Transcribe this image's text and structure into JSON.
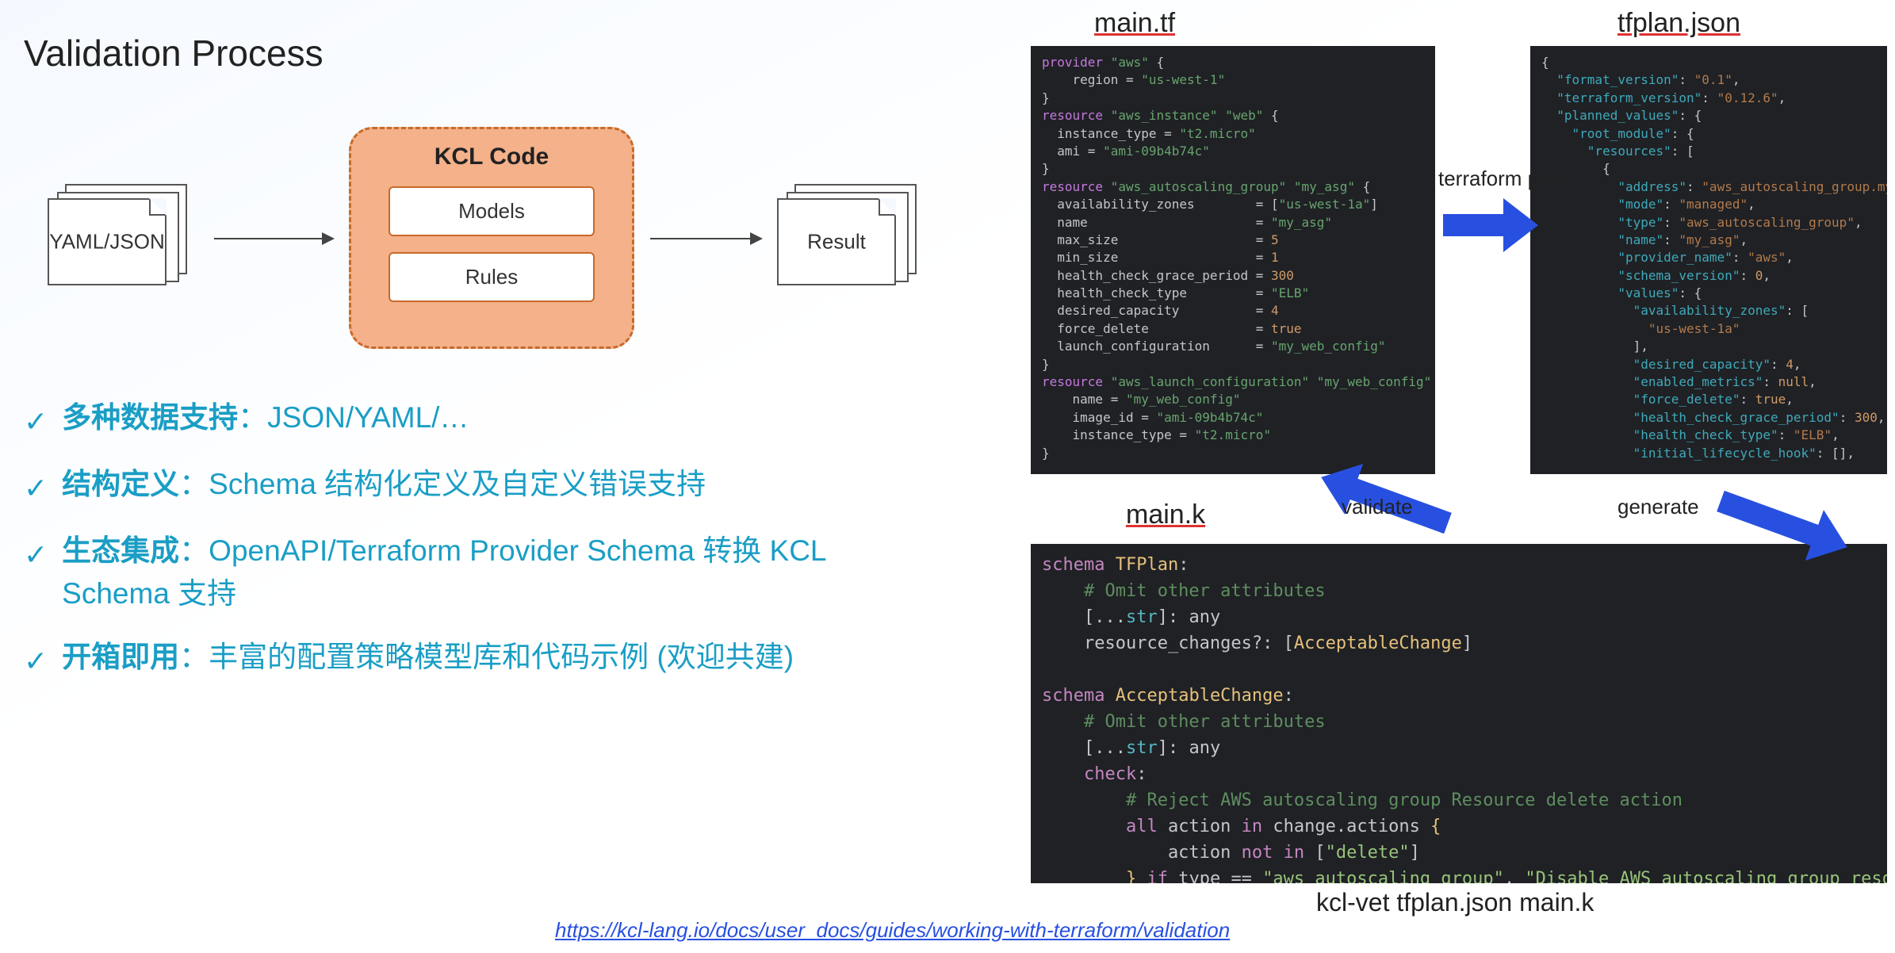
{
  "title": "Validation Process",
  "diagram": {
    "yaml_label": "YAML/JSON",
    "kcl_title": "KCL Code",
    "models_label": "Models",
    "rules_label": "Rules",
    "result_label": "Result"
  },
  "bullets": [
    {
      "bold": "多种数据支持",
      "rest": "：JSON/YAML/…"
    },
    {
      "bold": "结构定义",
      "rest": "：Schema 结构化定义及自定义错误支持"
    },
    {
      "bold": "生态集成",
      "rest": "：OpenAPI/Terraform Provider Schema 转换 KCL Schema 支持"
    },
    {
      "bold": "开箱即用",
      "rest": "：丰富的配置策略模型库和代码示例 (欢迎共建)"
    }
  ],
  "labels": {
    "maintf": "main.tf",
    "tfplan": "tfplan.json",
    "maink": "main.k",
    "terraform_plan": "terraform plan",
    "validate": "validate",
    "generate": "generate",
    "bottom_cmd": "kcl-vet tfplan.json main.k"
  },
  "code": {
    "maintf": [
      [
        "kw",
        "provider"
      ],
      [
        "id",
        " "
      ],
      [
        "str",
        "\"aws\""
      ],
      [
        "id",
        " {"
      ],
      null,
      [
        "id",
        "    region "
      ],
      [
        "eq",
        "= "
      ],
      [
        "str",
        "\"us-west-1\""
      ],
      null,
      [
        "id",
        "}"
      ],
      null,
      [
        "kw",
        "resource"
      ],
      [
        "id",
        " "
      ],
      [
        "str",
        "\"aws_instance\" \"web\""
      ],
      [
        "id",
        " {"
      ],
      null,
      [
        "id",
        "  instance_type "
      ],
      [
        "eq",
        "= "
      ],
      [
        "str",
        "\"t2.micro\""
      ],
      null,
      [
        "id",
        "  ami "
      ],
      [
        "eq",
        "= "
      ],
      [
        "str",
        "\"ami-09b4b74c\""
      ],
      null,
      [
        "id",
        "}"
      ],
      null,
      [
        "kw",
        "resource"
      ],
      [
        "id",
        " "
      ],
      [
        "str",
        "\"aws_autoscaling_group\" \"my_asg\""
      ],
      [
        "id",
        " {"
      ],
      null,
      [
        "id",
        "  availability_zones        "
      ],
      [
        "eq",
        "= "
      ],
      [
        "id",
        "["
      ],
      [
        "str",
        "\"us-west-1a\""
      ],
      [
        "id",
        "]"
      ],
      null,
      [
        "id",
        "  name                      "
      ],
      [
        "eq",
        "= "
      ],
      [
        "str",
        "\"my_asg\""
      ],
      null,
      [
        "id",
        "  max_size                  "
      ],
      [
        "eq",
        "= "
      ],
      [
        "num",
        "5"
      ],
      null,
      [
        "id",
        "  min_size                  "
      ],
      [
        "eq",
        "= "
      ],
      [
        "num",
        "1"
      ],
      null,
      [
        "id",
        "  health_check_grace_period "
      ],
      [
        "eq",
        "= "
      ],
      [
        "num",
        "300"
      ],
      null,
      [
        "id",
        "  health_check_type         "
      ],
      [
        "eq",
        "= "
      ],
      [
        "str",
        "\"ELB\""
      ],
      null,
      [
        "id",
        "  desired_capacity          "
      ],
      [
        "eq",
        "= "
      ],
      [
        "num",
        "4"
      ],
      null,
      [
        "id",
        "  force_delete              "
      ],
      [
        "eq",
        "= "
      ],
      [
        "bool",
        "true"
      ],
      null,
      [
        "id",
        "  launch_configuration      "
      ],
      [
        "eq",
        "= "
      ],
      [
        "str",
        "\"my_web_config\""
      ],
      null,
      [
        "id",
        "}"
      ],
      null,
      [
        "kw",
        "resource"
      ],
      [
        "id",
        " "
      ],
      [
        "str",
        "\"aws_launch_configuration\" \"my_web_config\""
      ],
      [
        "id",
        " {"
      ],
      null,
      [
        "id",
        "    name "
      ],
      [
        "eq",
        "= "
      ],
      [
        "str",
        "\"my_web_config\""
      ],
      null,
      [
        "id",
        "    image_id "
      ],
      [
        "eq",
        "= "
      ],
      [
        "str",
        "\"ami-09b4b74c\""
      ],
      null,
      [
        "id",
        "    instance_type "
      ],
      [
        "eq",
        "= "
      ],
      [
        "str",
        "\"t2.micro\""
      ],
      null,
      [
        "id",
        "}"
      ]
    ],
    "tfplan": [
      [
        "brc",
        "{"
      ],
      null,
      [
        "jkey",
        "  \"format_version\""
      ],
      [
        "punct",
        ": "
      ],
      [
        "jstr",
        "\"0.1\""
      ],
      [
        "punct",
        ","
      ],
      null,
      [
        "jkey",
        "  \"terraform_version\""
      ],
      [
        "punct",
        ": "
      ],
      [
        "jstr",
        "\"0.12.6\""
      ],
      [
        "punct",
        ","
      ],
      null,
      [
        "jkey",
        "  \"planned_values\""
      ],
      [
        "punct",
        ": {"
      ],
      null,
      [
        "jkey",
        "    \"root_module\""
      ],
      [
        "punct",
        ": {"
      ],
      null,
      [
        "jkey",
        "      \"resources\""
      ],
      [
        "punct",
        ": ["
      ],
      null,
      [
        "punct",
        "        {"
      ],
      null,
      [
        "jkey",
        "          \"address\""
      ],
      [
        "punct",
        ": "
      ],
      [
        "jstr",
        "\"aws_autoscaling_group.my_asg\""
      ],
      [
        "punct",
        ","
      ],
      null,
      [
        "jkey",
        "          \"mode\""
      ],
      [
        "punct",
        ": "
      ],
      [
        "jstr",
        "\"managed\""
      ],
      [
        "punct",
        ","
      ],
      null,
      [
        "jkey",
        "          \"type\""
      ],
      [
        "punct",
        ": "
      ],
      [
        "jstr",
        "\"aws_autoscaling_group\""
      ],
      [
        "punct",
        ","
      ],
      null,
      [
        "jkey",
        "          \"name\""
      ],
      [
        "punct",
        ": "
      ],
      [
        "jstr",
        "\"my_asg\""
      ],
      [
        "punct",
        ","
      ],
      null,
      [
        "jkey",
        "          \"provider_name\""
      ],
      [
        "punct",
        ": "
      ],
      [
        "jstr",
        "\"aws\""
      ],
      [
        "punct",
        ","
      ],
      null,
      [
        "jkey",
        "          \"schema_version\""
      ],
      [
        "punct",
        ": "
      ],
      [
        "jnum",
        "0"
      ],
      [
        "punct",
        ","
      ],
      null,
      [
        "jkey",
        "          \"values\""
      ],
      [
        "punct",
        ": {"
      ],
      null,
      [
        "jkey",
        "            \"availability_zones\""
      ],
      [
        "punct",
        ": ["
      ],
      null,
      [
        "jstr",
        "              \"us-west-1a\""
      ],
      null,
      [
        "punct",
        "            ],"
      ],
      null,
      [
        "jkey",
        "            \"desired_capacity\""
      ],
      [
        "punct",
        ": "
      ],
      [
        "jnum",
        "4"
      ],
      [
        "punct",
        ","
      ],
      null,
      [
        "jkey",
        "            \"enabled_metrics\""
      ],
      [
        "punct",
        ": "
      ],
      [
        "jbool",
        "null"
      ],
      [
        "punct",
        ","
      ],
      null,
      [
        "jkey",
        "            \"force_delete\""
      ],
      [
        "punct",
        ": "
      ],
      [
        "jbool",
        "true"
      ],
      [
        "punct",
        ","
      ],
      null,
      [
        "jkey",
        "            \"health_check_grace_period\""
      ],
      [
        "punct",
        ": "
      ],
      [
        "jnum",
        "300"
      ],
      [
        "punct",
        ","
      ],
      null,
      [
        "jkey",
        "            \"health_check_type\""
      ],
      [
        "punct",
        ": "
      ],
      [
        "jstr",
        "\"ELB\""
      ],
      [
        "punct",
        ","
      ],
      null,
      [
        "jkey",
        "            \"initial_lifecycle_hook\""
      ],
      [
        "punct",
        ": [],"
      ]
    ],
    "maink": [
      [
        "kw2",
        "schema"
      ],
      [
        "id",
        " "
      ],
      [
        "typ",
        "TFPlan"
      ],
      [
        "punct",
        ":"
      ],
      null,
      [
        "cmt",
        "    # Omit other attributes"
      ],
      null,
      [
        "punct",
        "    [..."
      ],
      [
        "fn",
        "str"
      ],
      [
        "punct",
        "]: "
      ],
      [
        "id",
        "any"
      ],
      null,
      [
        "id",
        "    resource_changes?: ["
      ],
      [
        "typ",
        "AcceptableChange"
      ],
      [
        "id",
        "]"
      ],
      null,
      [
        "id",
        " "
      ],
      null,
      [
        "kw2",
        "schema"
      ],
      [
        "id",
        " "
      ],
      [
        "typ",
        "AcceptableChange"
      ],
      [
        "punct",
        ":"
      ],
      null,
      [
        "cmt",
        "    # Omit other attributes"
      ],
      null,
      [
        "punct",
        "    [..."
      ],
      [
        "fn",
        "str"
      ],
      [
        "punct",
        "]: "
      ],
      [
        "id",
        "any"
      ],
      null,
      [
        "kw2",
        "    check"
      ],
      [
        "punct",
        ":"
      ],
      null,
      [
        "cmt",
        "        # Reject AWS autoscaling group Resource delete action"
      ],
      null,
      [
        "kw2",
        "        all"
      ],
      [
        "id",
        " action "
      ],
      [
        "kw2",
        "in"
      ],
      [
        "id",
        " change.actions "
      ],
      [
        "typ",
        "{"
      ],
      null,
      [
        "id",
        "            action "
      ],
      [
        "kw2",
        "not in"
      ],
      [
        "id",
        " ["
      ],
      [
        "strg",
        "\"delete\""
      ],
      [
        "id",
        "]"
      ],
      null,
      [
        "typ",
        "        }"
      ],
      [
        "id",
        " "
      ],
      [
        "kw2",
        "if"
      ],
      [
        "id",
        " type == "
      ],
      [
        "strg",
        "\"aws_autoscaling_group\""
      ],
      [
        "id",
        ", "
      ],
      [
        "strg",
        "\"Disable AWS autoscaling group resourc"
      ]
    ]
  },
  "footer_link": "https://kcl-lang.io/docs/user_docs/guides/working-with-terraform/validation"
}
